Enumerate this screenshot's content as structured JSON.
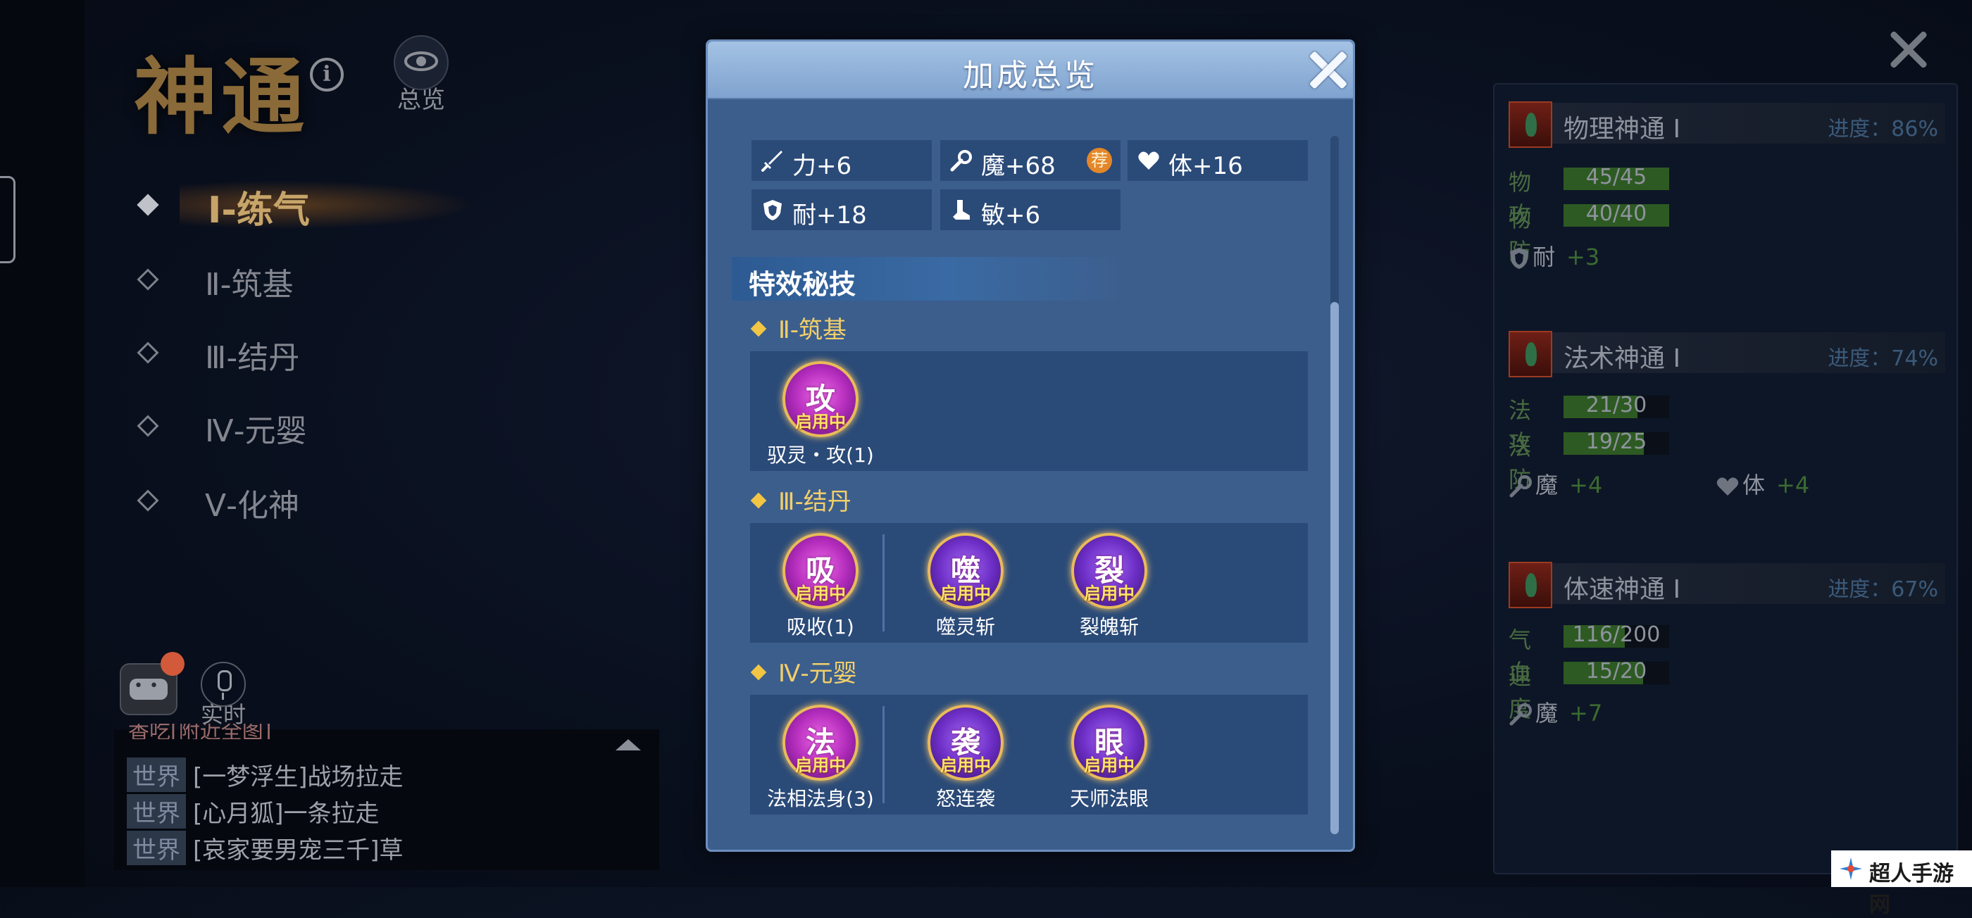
{
  "left_page": {
    "title": "神通",
    "overview_label": "总览",
    "levels": [
      {
        "label": "Ⅰ-练气",
        "active": true
      },
      {
        "label": "Ⅱ-筑基",
        "active": false
      },
      {
        "label": "Ⅲ-结丹",
        "active": false
      },
      {
        "label": "Ⅳ-元婴",
        "active": false
      },
      {
        "label": "Ⅴ-化神",
        "active": false
      }
    ]
  },
  "chat": {
    "voice_label": "实时",
    "cut_line": "香吃[附近全图]",
    "messages": [
      {
        "channel": "世界",
        "text": "[一梦浮生]战场拉走"
      },
      {
        "channel": "世界",
        "text": "[心月狐]一条拉走"
      },
      {
        "channel": "世界",
        "text": "[哀家要男宠三千]草"
      }
    ]
  },
  "right_panel": {
    "sections": [
      {
        "title": "物理神通 Ⅰ",
        "progress_label": "进度：86%",
        "stats": [
          {
            "label": "物攻",
            "value": "45/45",
            "fill": 1.0
          },
          {
            "label": "物防",
            "value": "40/40",
            "fill": 1.0
          }
        ],
        "bonuses": [
          {
            "icon": "shield-icon",
            "label": "耐",
            "value": "+3"
          }
        ]
      },
      {
        "title": "法术神通 Ⅰ",
        "progress_label": "进度：74%",
        "stats": [
          {
            "label": "法攻",
            "value": "21/30",
            "fill": 0.7
          },
          {
            "label": "法防",
            "value": "19/25",
            "fill": 0.76
          }
        ],
        "bonuses": [
          {
            "icon": "wand-icon",
            "label": "魔",
            "value": "+4"
          },
          {
            "icon": "heart-icon",
            "label": "体",
            "value": "+4"
          }
        ]
      },
      {
        "title": "体速神通 Ⅰ",
        "progress_label": "进度：67%",
        "stats": [
          {
            "label": "气血",
            "value": "116/200",
            "fill": 0.58
          },
          {
            "label": "速度",
            "value": "15/20",
            "fill": 0.75
          }
        ],
        "bonuses": [
          {
            "icon": "wand-icon",
            "label": "魔",
            "value": "+7"
          }
        ]
      }
    ]
  },
  "modal": {
    "title": "加成总览",
    "attributes": [
      {
        "icon": "sword-icon",
        "text": "力+6"
      },
      {
        "icon": "wand-icon",
        "text": "魔+68",
        "badge": "荐"
      },
      {
        "icon": "heart-icon",
        "text": "体+16"
      },
      {
        "icon": "shield-icon",
        "text": "耐+18"
      },
      {
        "icon": "boot-icon",
        "text": "敏+6"
      }
    ],
    "section_title": "特效秘技",
    "tiers": [
      {
        "label": "Ⅱ-筑基",
        "skills": [
          {
            "glyph": "攻",
            "status": "启用中",
            "name": "驭灵・攻(1)",
            "style": "pink"
          }
        ]
      },
      {
        "label": "Ⅲ-结丹",
        "skills": [
          {
            "glyph": "吸",
            "status": "启用中",
            "name": "吸收(1)",
            "style": "pink"
          },
          {
            "glyph": "噬",
            "status": "启用中",
            "name": "噬灵斩",
            "style": "blue"
          },
          {
            "glyph": "裂",
            "status": "启用中",
            "name": "裂魄斩",
            "style": "blue"
          }
        ]
      },
      {
        "label": "Ⅳ-元婴",
        "skills": [
          {
            "glyph": "法",
            "status": "启用中",
            "name": "法相法身(3)",
            "style": "pink"
          },
          {
            "glyph": "袭",
            "status": "启用中",
            "name": "怒连袭",
            "style": "blue"
          },
          {
            "glyph": "眼",
            "status": "启用中",
            "name": "天师法眼",
            "style": "blue"
          }
        ]
      }
    ]
  },
  "watermark": "超人手游网",
  "colors": {
    "modal_bg": "#3c5e8d",
    "modal_header": "#a4c2e4",
    "tier_gold": "#f2cf6a",
    "stat_fill": "#2d5a22",
    "bonus_green": "#3b6a32",
    "orb_gold_border": "#e9bb59"
  }
}
